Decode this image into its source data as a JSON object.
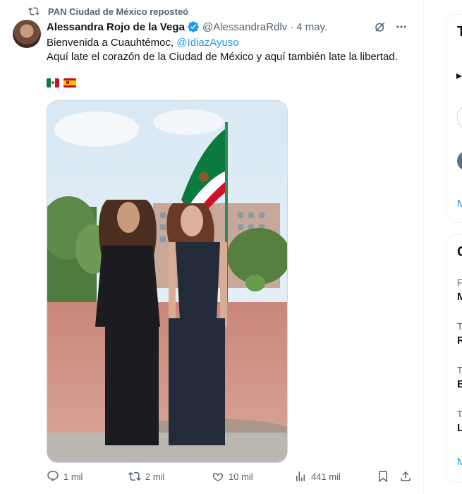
{
  "repost": {
    "label": "PAN Ciudad de México reposteó"
  },
  "tweet": {
    "author_name": "Alessandra Rojo de la Vega",
    "handle": "@AlessandraRdlv",
    "separator": "·",
    "date": "4 may.",
    "line1_prefix": "Bienvenida a Cuauhtémoc, ",
    "line1_mention": "@IdiazAyuso",
    "line2": "Aquí late el corazón de la Ciudad de México y aquí también late la libertad.",
    "flags": [
      "mexico-flag",
      "spain-flag"
    ]
  },
  "actions": {
    "replies": "1 mil",
    "reposts": "2 mil",
    "likes": "10 mil",
    "views": "441 mil"
  },
  "right_column": {
    "card1_title": "T",
    "card1_link": "M",
    "card2_title": "C",
    "items": [
      {
        "small": "F",
        "bold": "M"
      },
      {
        "small": "T",
        "bold": "R"
      },
      {
        "small": "T",
        "bold": "E"
      },
      {
        "small": "T",
        "bold": "L"
      }
    ],
    "card2_link": "M"
  },
  "colors": {
    "link": "#1d9bf0",
    "muted": "#536471",
    "verified": "#1d9bf0"
  }
}
